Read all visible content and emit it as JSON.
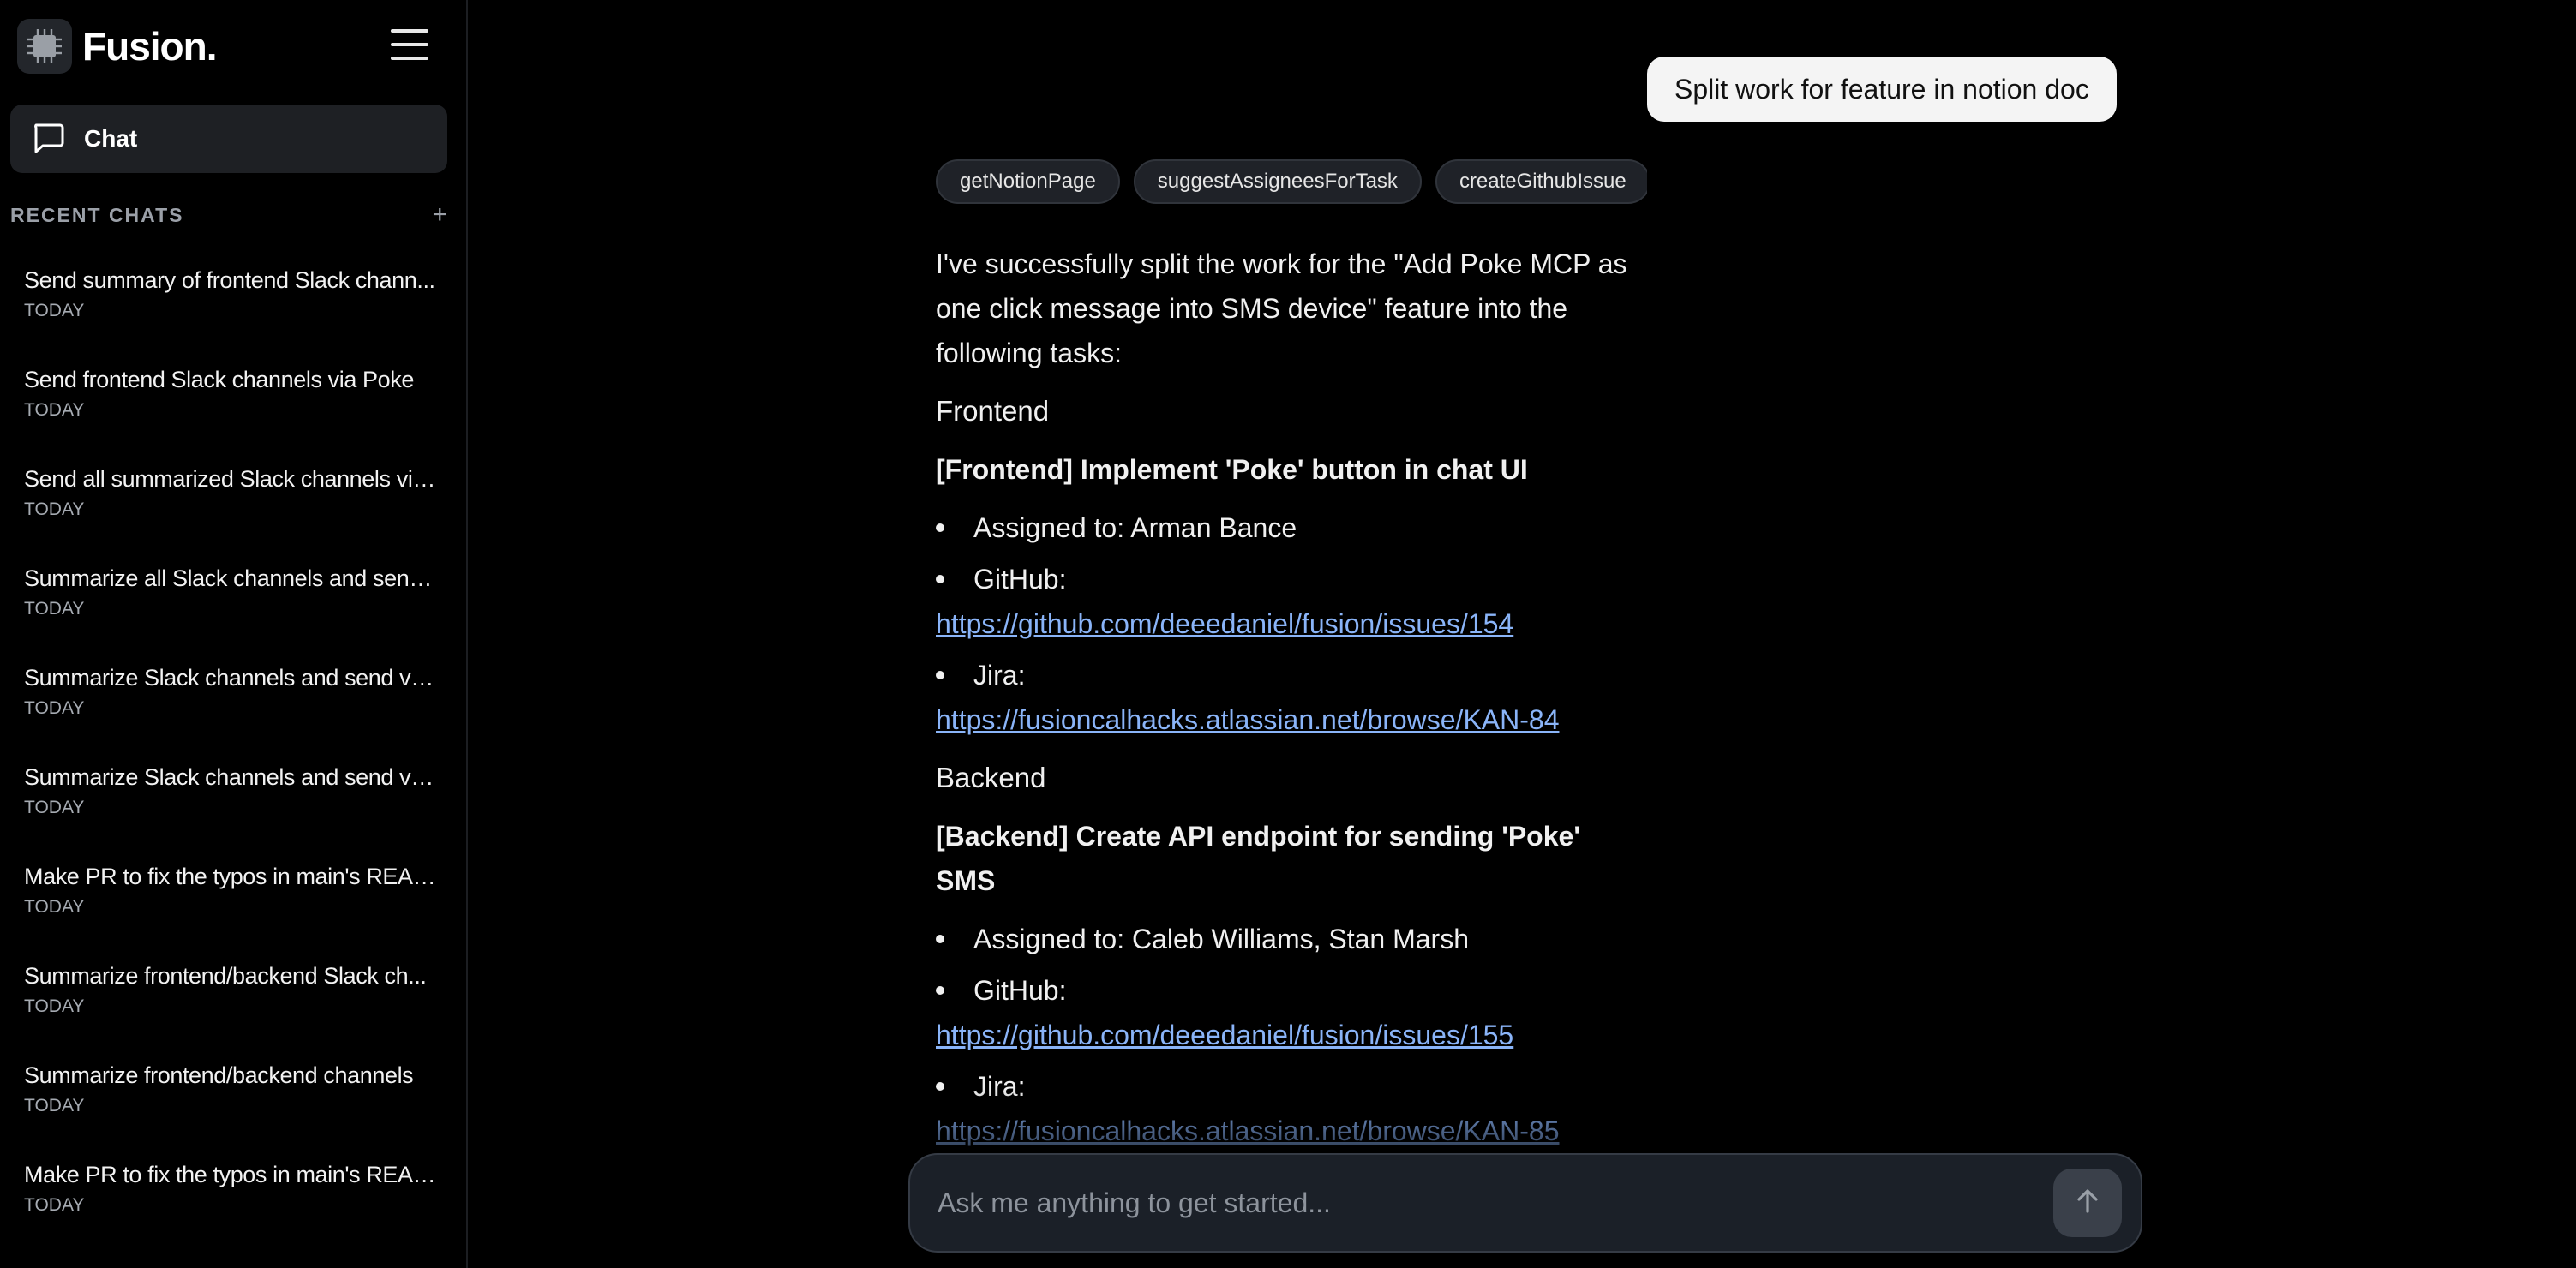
{
  "app": {
    "name": "Fusion."
  },
  "sidebar": {
    "chat_label": "Chat",
    "recent_title": "RECENT CHATS",
    "recent_add": "+",
    "chats": [
      {
        "title": "Send summary of frontend Slack chann...",
        "date": "TODAY"
      },
      {
        "title": "Send frontend Slack channels via Poke",
        "date": "TODAY"
      },
      {
        "title": "Send all summarized Slack channels via...",
        "date": "TODAY"
      },
      {
        "title": "Summarize all Slack channels and send ...",
        "date": "TODAY"
      },
      {
        "title": "Summarize Slack channels and send via...",
        "date": "TODAY"
      },
      {
        "title": "Summarize Slack channels and send via...",
        "date": "TODAY"
      },
      {
        "title": "Make PR to fix the typos in main's READ...",
        "date": "TODAY"
      },
      {
        "title": "Summarize frontend/backend Slack ch...",
        "date": "TODAY"
      },
      {
        "title": "Summarize frontend/backend channels",
        "date": "TODAY"
      },
      {
        "title": "Make PR to fix the typos in main's READ...",
        "date": "TODAY"
      }
    ]
  },
  "conversation": {
    "user_message": "Split work for feature in notion doc",
    "tools": [
      "getNotionPage",
      "suggestAssigneesForTask",
      "createGithubIssue"
    ],
    "intro": "I've successfully split the work for the \"Add Poke MCP as one click message into SMS device\" feature into the following tasks:",
    "sections": [
      {
        "heading": "Frontend",
        "task": "[Frontend] Implement 'Poke' button in chat UI",
        "assigned": "Assigned to: Arman Bance",
        "github_label": "GitHub:",
        "github_url": "https://github.com/deeedaniel/fusion/issues/154",
        "jira_label": "Jira:",
        "jira_url": "https://fusioncalhacks.atlassian.net/browse/KAN-84"
      },
      {
        "heading": "Backend",
        "task": "[Backend] Create API endpoint for sending 'Poke' SMS",
        "assigned": "Assigned to: Caleb Williams, Stan Marsh",
        "github_label": "GitHub:",
        "github_url": "https://github.com/deeedaniel/fusion/issues/155",
        "jira_label": "Jira:",
        "jira_url": "https://fusioncalhacks.atlassian.net/browse/KAN-85"
      }
    ]
  },
  "composer": {
    "placeholder": "Ask me anything to get started..."
  },
  "icons": {
    "logo": "chip-logo-icon",
    "menu": "hamburger-menu-icon",
    "chat": "chat-bubble-icon",
    "send": "arrow-up-icon"
  }
}
